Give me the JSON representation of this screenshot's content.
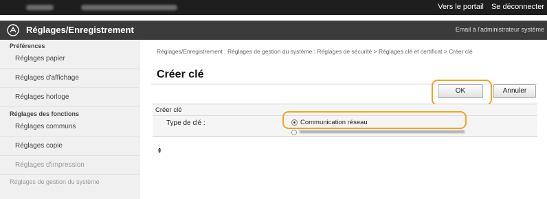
{
  "header": {
    "portal_link": "Vers le portail",
    "logout_link": "Se déconnecter",
    "app_title": "Réglages/Enregistrement",
    "admin_email_link": "Email à l'administrateur système"
  },
  "sidebar": {
    "sections": [
      {
        "label": "Préférences",
        "items": [
          "Réglages papier",
          "Réglages d'affichage",
          "Réglages horloge"
        ]
      },
      {
        "label": "Réglages des fonctions",
        "items": [
          "Réglages communs",
          "Réglages copie",
          "Réglages d'impression"
        ]
      },
      {
        "label": "Réglages de gestion du système",
        "items": []
      }
    ]
  },
  "main": {
    "breadcrumb": "Réglages/Enregistrement : Réglages de gestion du système : Réglages de sécurité > Réglages clé et certificat > Créer clé",
    "page_title": "Créer clé",
    "ok_label": "OK",
    "cancel_label": "Annuler",
    "section_title": "Créer clé",
    "key_type_label": "Type de clé :",
    "key_type_option_selected": "Communication réseau",
    "to_top_icon": "⇞"
  },
  "colors": {
    "highlight_ring": "#f0a51e",
    "title_bar": "#3b3b3b",
    "top_bar": "#1e1e1e"
  }
}
